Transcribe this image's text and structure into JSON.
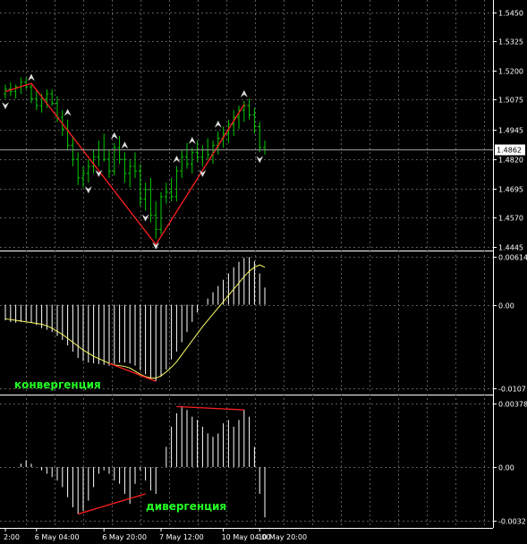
{
  "chart_data": [
    {
      "type": "bar",
      "name": "price",
      "ylim": [
        1.4445,
        1.5475
      ],
      "y_ticks": [
        "1.5450",
        "1.5325",
        "1.5200",
        "1.5075",
        "1.4945",
        "1.4820",
        "1.4695",
        "1.4570",
        "1.4445"
      ],
      "current_price": "1.4862",
      "bars": [
        [
          1.51,
          1.514,
          1.508,
          1.512
        ],
        [
          1.512,
          1.515,
          1.509,
          1.511
        ],
        [
          1.511,
          1.514,
          1.508,
          1.513
        ],
        [
          1.513,
          1.517,
          1.51,
          1.515
        ],
        [
          1.515,
          1.517,
          1.512,
          1.513
        ],
        [
          1.513,
          1.514,
          1.506,
          1.508
        ],
        [
          1.508,
          1.512,
          1.503,
          1.505
        ],
        [
          1.505,
          1.51,
          1.502,
          1.508
        ],
        [
          1.508,
          1.512,
          1.504,
          1.51
        ],
        [
          1.51,
          1.512,
          1.505,
          1.506
        ],
        [
          1.506,
          1.509,
          1.498,
          1.5
        ],
        [
          1.5,
          1.503,
          1.492,
          1.495
        ],
        [
          1.495,
          1.499,
          1.486,
          1.488
        ],
        [
          1.488,
          1.492,
          1.479,
          1.482
        ],
        [
          1.482,
          1.485,
          1.471,
          1.474
        ],
        [
          1.474,
          1.479,
          1.47,
          1.476
        ],
        [
          1.476,
          1.482,
          1.472,
          1.479
        ],
        [
          1.479,
          1.486,
          1.476,
          1.483
        ],
        [
          1.483,
          1.49,
          1.479,
          1.486
        ],
        [
          1.486,
          1.493,
          1.481,
          1.482
        ],
        [
          1.482,
          1.486,
          1.474,
          1.477
        ],
        [
          1.477,
          1.489,
          1.475,
          1.487
        ],
        [
          1.487,
          1.492,
          1.48,
          1.482
        ],
        [
          1.482,
          1.485,
          1.472,
          1.476
        ],
        [
          1.476,
          1.482,
          1.47,
          1.479
        ],
        [
          1.479,
          1.485,
          1.474,
          1.477
        ],
        [
          1.477,
          1.48,
          1.462,
          1.465
        ],
        [
          1.465,
          1.472,
          1.46,
          1.469
        ],
        [
          1.469,
          1.474,
          1.455,
          1.458
        ],
        [
          1.458,
          1.464,
          1.448,
          1.452
        ],
        [
          1.452,
          1.468,
          1.45,
          1.466
        ],
        [
          1.466,
          1.472,
          1.463,
          1.468
        ],
        [
          1.468,
          1.474,
          1.464,
          1.466
        ],
        [
          1.466,
          1.479,
          1.464,
          1.477
        ],
        [
          1.477,
          1.486,
          1.474,
          1.483
        ],
        [
          1.483,
          1.489,
          1.478,
          1.48
        ],
        [
          1.48,
          1.487,
          1.476,
          1.485
        ],
        [
          1.485,
          1.49,
          1.481,
          1.483
        ],
        [
          1.483,
          1.488,
          1.479,
          1.486
        ],
        [
          1.486,
          1.491,
          1.482,
          1.484
        ],
        [
          1.484,
          1.49,
          1.48,
          1.488
        ],
        [
          1.488,
          1.494,
          1.484,
          1.491
        ],
        [
          1.491,
          1.496,
          1.487,
          1.493
        ],
        [
          1.493,
          1.499,
          1.489,
          1.497
        ],
        [
          1.497,
          1.503,
          1.492,
          1.5
        ],
        [
          1.5,
          1.505,
          1.495,
          1.503
        ],
        [
          1.503,
          1.507,
          1.498,
          1.505
        ],
        [
          1.505,
          1.508,
          1.499,
          1.501
        ],
        [
          1.501,
          1.504,
          1.493,
          1.496
        ],
        [
          1.496,
          1.498,
          1.485,
          1.487
        ],
        [
          1.487,
          1.49,
          1.484,
          1.486
        ]
      ],
      "fractal_up_indices": [
        5,
        12,
        21,
        23,
        33,
        36,
        41,
        46
      ],
      "fractal_down_indices": [
        0,
        16,
        18,
        27,
        29,
        38,
        49
      ],
      "zigzag": [
        [
          0,
          1.511
        ],
        [
          5,
          1.5145
        ],
        [
          29,
          1.4455
        ],
        [
          46,
          1.5055
        ]
      ]
    },
    {
      "type": "bar",
      "name": "macd",
      "ylim": [
        -0.0107,
        0.00614
      ],
      "y_ticks": [
        "0.00614",
        "0.00",
        "-0.0107"
      ],
      "values": [
        -0.002,
        -0.0022,
        -0.0023,
        -0.0022,
        -0.0021,
        -0.0023,
        -0.0026,
        -0.003,
        -0.0032,
        -0.0035,
        -0.004,
        -0.0045,
        -0.0052,
        -0.006,
        -0.0068,
        -0.0072,
        -0.0074,
        -0.0075,
        -0.0076,
        -0.0077,
        -0.0078,
        -0.0076,
        -0.0074,
        -0.0074,
        -0.0075,
        -0.0078,
        -0.0084,
        -0.0089,
        -0.0094,
        -0.0098,
        -0.0092,
        -0.0083,
        -0.007,
        -0.006,
        -0.0048,
        -0.0035,
        -0.0022,
        -0.001,
        0.0,
        0.0008,
        0.0016,
        0.0024,
        0.0032,
        0.004,
        0.0048,
        0.0055,
        0.006,
        0.0061,
        0.0056,
        0.004,
        0.0022
      ],
      "signal": [
        -0.0018,
        -0.0019,
        -0.002,
        -0.0021,
        -0.0022,
        -0.0023,
        -0.0024,
        -0.0025,
        -0.0027,
        -0.003,
        -0.0034,
        -0.0038,
        -0.0043,
        -0.0048,
        -0.0053,
        -0.0058,
        -0.0062,
        -0.0066,
        -0.0069,
        -0.0072,
        -0.0075,
        -0.0077,
        -0.0078,
        -0.0079,
        -0.0081,
        -0.0085,
        -0.0089,
        -0.0092,
        -0.0094,
        -0.0094,
        -0.0091,
        -0.0086,
        -0.008,
        -0.0073,
        -0.0064,
        -0.0055,
        -0.0046,
        -0.0037,
        -0.0028,
        -0.002,
        -0.0012,
        -0.0004,
        0.0004,
        0.0012,
        0.002,
        0.0028,
        0.0036,
        0.0043,
        0.0048,
        0.0051,
        0.0048
      ],
      "divergence_line": [
        [
          20,
          -0.0075
        ],
        [
          29,
          -0.0098
        ]
      ],
      "annotation": "конвергенция"
    },
    {
      "type": "bar",
      "name": "oscillator",
      "ylim": [
        -0.0032,
        0.00378
      ],
      "y_ticks": [
        "0.00378",
        "0.00",
        "-0.0032"
      ],
      "values": [
        0.0,
        0.0,
        0.0,
        0.0002,
        0.0004,
        0.0002,
        0.0,
        -0.0002,
        -0.0004,
        -0.0006,
        -0.0008,
        -0.0012,
        -0.0018,
        -0.0024,
        -0.0028,
        -0.0026,
        -0.002,
        -0.0012,
        -0.0004,
        -0.0002,
        -0.0004,
        -0.0008,
        -0.001,
        -0.0016,
        -0.0022,
        -0.001,
        -0.0002,
        -0.0008,
        -0.0014,
        -0.0016,
        0.0,
        0.0012,
        0.0024,
        0.0032,
        0.0036,
        0.0034,
        0.003,
        0.0028,
        0.0024,
        0.002,
        0.0018,
        0.002,
        0.0026,
        0.0028,
        0.0024,
        0.0028,
        0.0034,
        0.003,
        0.0012,
        -0.0016,
        -0.003
      ],
      "divergence_lines": [
        [
          [
            33,
            0.0036
          ],
          [
            46,
            0.0034
          ]
        ],
        [
          [
            14,
            -0.0028
          ],
          [
            27,
            -0.0016
          ]
        ]
      ],
      "annotation": "дивергенция"
    }
  ],
  "x_labels": [
    {
      "label": "2:00",
      "index": 0
    },
    {
      "label": "6 May 04:00",
      "index": 6
    },
    {
      "label": "6 May 20:00",
      "index": 19
    },
    {
      "label": "7 May 12:00",
      "index": 30
    },
    {
      "label": "10 May 04:00",
      "index": 42
    },
    {
      "label": "10 May 20:00",
      "index": 49
    }
  ],
  "colors": {
    "background": "#000000",
    "bars": "#00cc00",
    "histogram": "#ffffff",
    "signal": "#ffff66",
    "zigzag": "#ff2020",
    "grid": "#5a5a5a",
    "notes": "#22ff22"
  }
}
